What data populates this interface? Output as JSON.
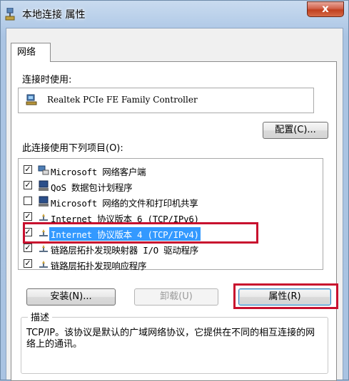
{
  "window": {
    "title": "本地连接 属性",
    "close_label": "x"
  },
  "tabs": [
    {
      "label": "网络",
      "selected": true
    }
  ],
  "connect_using": {
    "label": "连接时使用:",
    "adapter": "Realtek PCIe FE Family Controller",
    "configure_button": "配置(C)..."
  },
  "components": {
    "label": "此连接使用下列项目(O):",
    "items": [
      {
        "label": "Microsoft 网络客户端",
        "checked": true,
        "icon": "network-client-icon"
      },
      {
        "label": "QoS 数据包计划程序",
        "checked": true,
        "icon": "qos-scheduler-icon"
      },
      {
        "label": "Microsoft 网络的文件和打印机共享",
        "checked": false,
        "icon": "file-printer-sharing-icon"
      },
      {
        "label": "Internet 协议版本 6 (TCP/IPv6)",
        "checked": true,
        "icon": "protocol-icon"
      },
      {
        "label": "Internet 协议版本 4 (TCP/IPv4)",
        "checked": true,
        "icon": "protocol-icon",
        "selected": true,
        "highlighted": true
      },
      {
        "label": "链路层拓扑发现映射器 I/O 驱动程序",
        "checked": true,
        "icon": "protocol-icon"
      },
      {
        "label": "链路层拓扑发现响应程序",
        "checked": true,
        "icon": "protocol-icon"
      }
    ]
  },
  "actions": {
    "install": "安装(N)...",
    "uninstall": "卸载(U)",
    "properties": "属性(R)"
  },
  "description": {
    "legend": "描述",
    "text": "TCP/IP。该协议是默认的广域网络协议，它提供在不同的相互连接的网络上的通讯。"
  },
  "colors": {
    "highlight_border": "#c8102e",
    "selection": "#3399ff"
  }
}
